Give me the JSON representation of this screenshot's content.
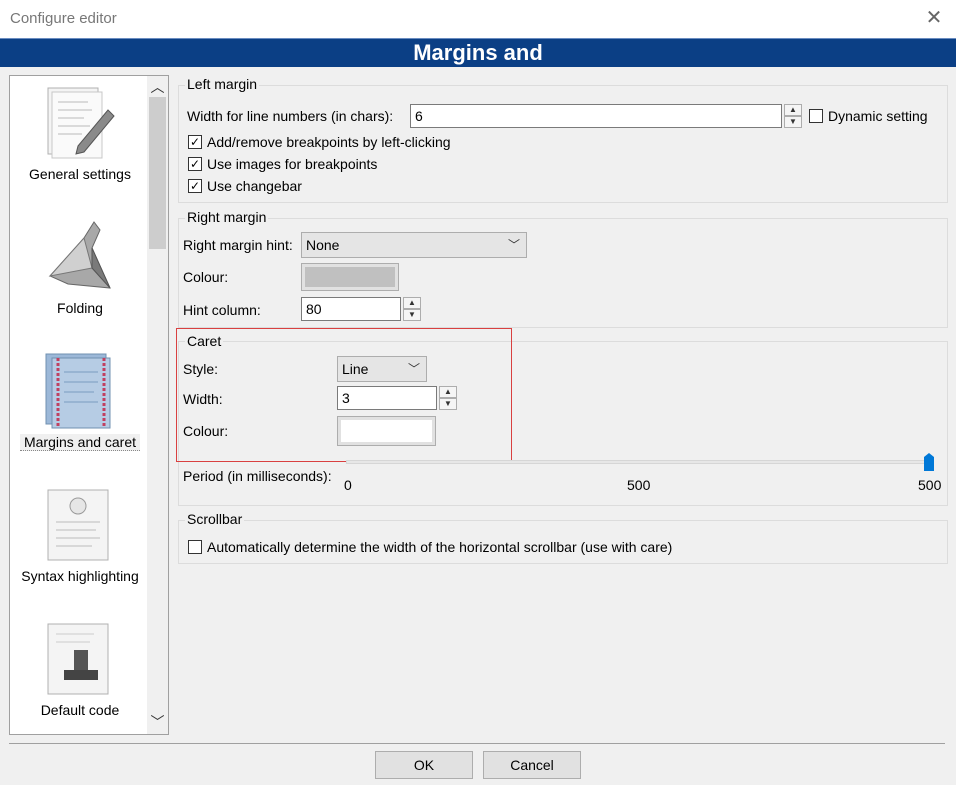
{
  "window": {
    "title": "Configure editor",
    "close_icon": "close-icon"
  },
  "banner": {
    "text": "Margins and"
  },
  "sidebar": {
    "items": [
      {
        "label": "General settings",
        "icon": "pencil-document-icon"
      },
      {
        "label": "Folding",
        "icon": "origami-bird-icon"
      },
      {
        "label": "Margins and caret",
        "icon": "margins-document-icon",
        "selected": true
      },
      {
        "label": "Syntax highlighting",
        "icon": "lightbulb-document-icon"
      },
      {
        "label": "Default code",
        "icon": "stamp-document-icon"
      }
    ]
  },
  "left_margin": {
    "title": "Left margin",
    "width_label": "Width for line numbers (in chars):",
    "width_value": "6",
    "dynamic_label": "Dynamic setting",
    "dynamic_checked": false,
    "checks": [
      {
        "label": "Add/remove breakpoints by left-clicking",
        "checked": true
      },
      {
        "label": "Use images for breakpoints",
        "checked": true
      },
      {
        "label": "Use changebar",
        "checked": true
      }
    ]
  },
  "right_margin": {
    "title": "Right margin",
    "hint_label": "Right margin hint:",
    "hint_value": "None",
    "colour_label": "Colour:",
    "colour_value": "#c0c0c0",
    "column_label": "Hint column:",
    "column_value": "80"
  },
  "caret": {
    "title": "Caret",
    "style_label": "Style:",
    "style_value": "Line",
    "width_label": "Width:",
    "width_value": "3",
    "colour_label": "Colour:",
    "colour_value": "#ffffff",
    "period_label": "Period (in milliseconds):",
    "period_value": 500,
    "period_min_label": "0",
    "period_mid_label": "500",
    "period_max_label": "500"
  },
  "scrollbar": {
    "title": "Scrollbar",
    "auto_label": "Automatically determine the width of the horizontal scrollbar (use with care)",
    "auto_checked": false
  },
  "buttons": {
    "ok": "OK",
    "cancel": "Cancel"
  },
  "colors": {
    "banner": "#0b3f85",
    "highlight": "#d94040",
    "slider_thumb": "#0078d7"
  }
}
